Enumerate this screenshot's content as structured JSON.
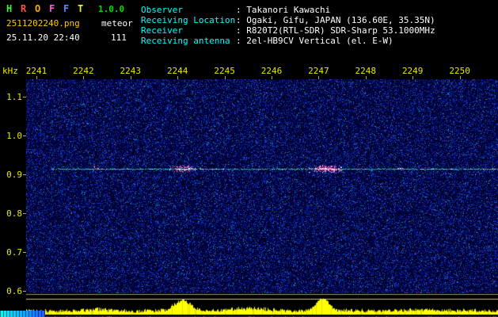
{
  "app": {
    "name_letters": [
      "H",
      "R",
      "O",
      "F",
      "F",
      "T"
    ],
    "letter_colors": [
      "#44ee44",
      "#ff5050",
      "#ffaa00",
      "#ff55dd",
      "#5588ff",
      "#eeee44"
    ],
    "version": "1.0.0",
    "output_filename": "2511202240.png",
    "mode_label": "meteor",
    "timestamp": "25.11.20 22:40",
    "count": "111"
  },
  "station_info": {
    "separator": ":",
    "rows": [
      {
        "label": "Observer",
        "value": "Takanori Kawachi"
      },
      {
        "label": "Receiving Location",
        "value": "Ogaki, Gifu, JAPAN (136.60E, 35.35N)"
      },
      {
        "label": "Receiver",
        "value": "R820T2(RTL-SDR) SDR-Sharp 53.1000MHz"
      },
      {
        "label": "Receiving antenna",
        "value": "2el-HB9CV Vertical (el. E-W)"
      }
    ]
  },
  "chart_data": {
    "type": "heatmap",
    "subtype": "radio-meteor-spectrogram",
    "y_axis_unit": "kHz",
    "y_ticks": [
      "1.1",
      "1.0",
      "0.9",
      "0.8",
      "0.7",
      "0.6"
    ],
    "y_range_khz": [
      0.6,
      1.15
    ],
    "x_ticks": [
      "2241",
      "2242",
      "2243",
      "2244",
      "2245",
      "2246",
      "2247",
      "2248",
      "2249",
      "2250"
    ],
    "x_axis_meaning": "time (hhmm)",
    "grid": false,
    "carrier_line_khz": 0.91,
    "meteor_echoes": [
      {
        "time_hhmm": "2244",
        "freq_khz": 0.91,
        "strength": "medium"
      },
      {
        "time_hhmm": "2247",
        "freq_khz": 0.91,
        "strength": "strong"
      }
    ],
    "level_meter_peaks_hhmm": [
      "2244",
      "2247"
    ]
  },
  "colors": {
    "background": "#000000",
    "info_label_cyan": "#00ffff",
    "text_white": "#ffffff",
    "axis_label_yellow": "#e8e800",
    "filename_orange": "#ffc800",
    "version_green": "#00dd00",
    "noise_blue": "#2244dd",
    "carrier_line_green": "#40e0a0",
    "echo_pink": "#ff6ec7",
    "echo_red": "#ff2e6e",
    "echo_white": "#ffffff",
    "meter_bar": "#ffff00",
    "meter_line_upper": "#9a9a50",
    "meter_line_lower": "#c8c860",
    "meter_bottom_line": "#2020a0",
    "corner_strip_cyan": "#00e0ff"
  }
}
